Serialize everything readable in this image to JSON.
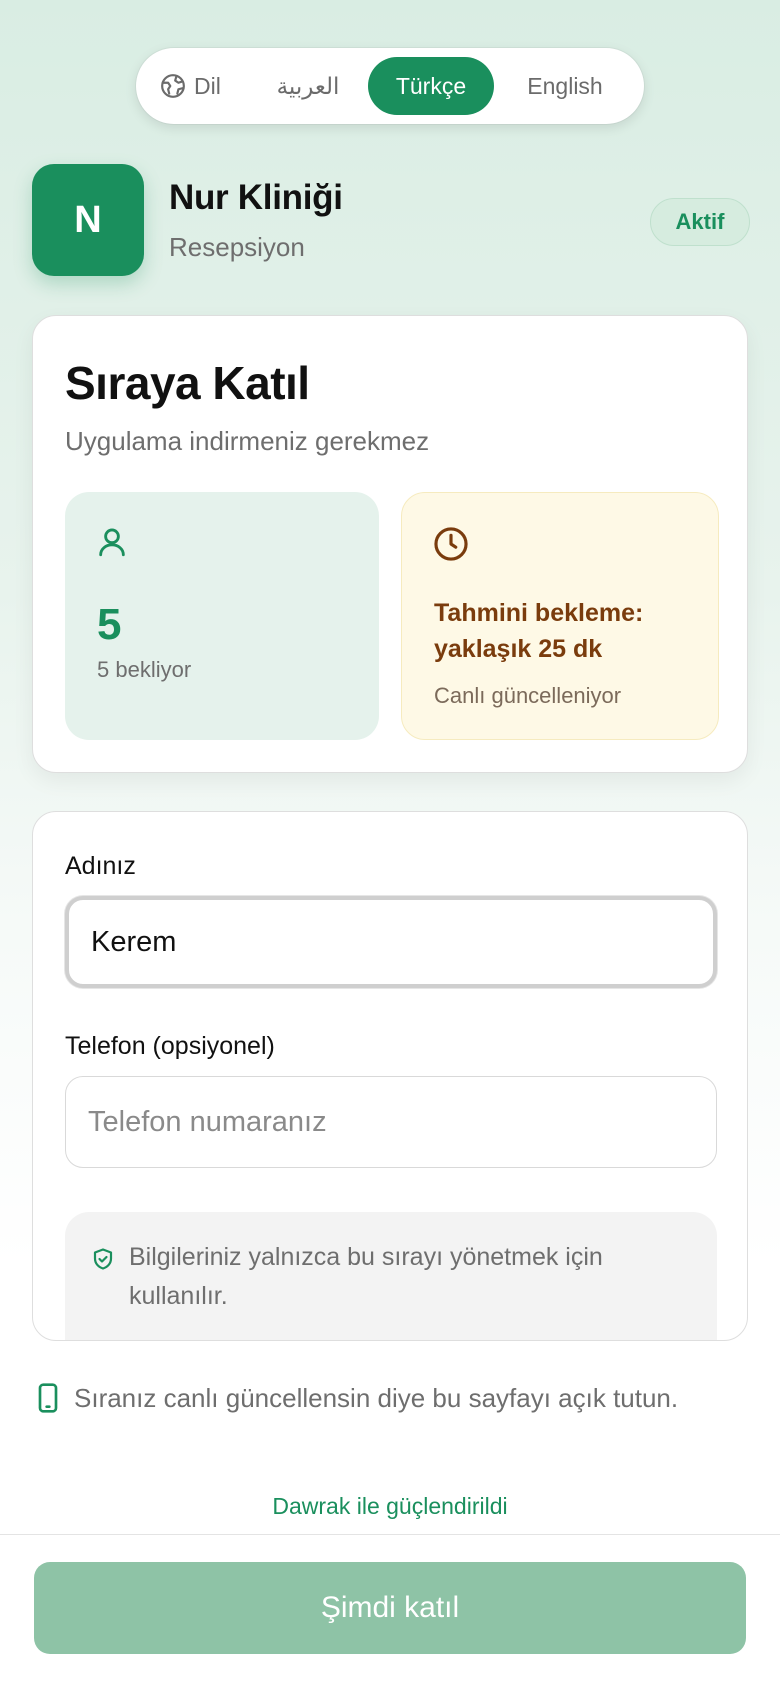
{
  "language_switcher": {
    "label": "Dil",
    "options": [
      "العربية",
      "Türkçe",
      "English"
    ],
    "selected": "Türkçe"
  },
  "clinic": {
    "initial": "N",
    "name": "Nur Kliniği",
    "role": "Resepsiyon",
    "status": "Aktif"
  },
  "queue": {
    "title": "Sıraya Katıl",
    "subtitle": "Uygulama indirmeniz gerekmez",
    "waiting_count": "5",
    "waiting_label": "5 bekliyor",
    "eta_title": "Tahmini bekleme: yaklaşık 25 dk",
    "eta_note": "Canlı güncelleniyor"
  },
  "form": {
    "name_label": "Adınız",
    "name_value": "Kerem",
    "phone_label": "Telefon (opsiyonel)",
    "phone_placeholder": "Telefon numaranız",
    "privacy_text": "Bilgileriniz yalnızca bu sırayı yönetmek için kullanılır."
  },
  "keep_open_text": "Sıranız canlı güncellensin diye bu sayfayı açık tutun.",
  "powered_by": "Dawrak ile güçlendirildi",
  "join_button": "Şimdi katıl",
  "colors": {
    "brand": "#1a8f5d",
    "brand_disabled": "#8ec3a6",
    "eta_text": "#7a3c0d",
    "eta_bg": "#fef9e6"
  }
}
